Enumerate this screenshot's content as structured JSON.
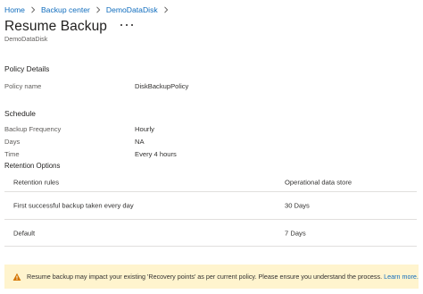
{
  "breadcrumb": {
    "items": [
      "Home",
      "Backup center",
      "DemoDataDisk"
    ]
  },
  "header": {
    "title": "Resume Backup",
    "subtitle": "DemoDataDisk",
    "more_icon": "more-horizontal-icon"
  },
  "policy_details": {
    "heading": "Policy Details",
    "rows": [
      {
        "label": "Policy name",
        "value": "DiskBackupPolicy"
      }
    ]
  },
  "schedule": {
    "heading": "Schedule",
    "rows": [
      {
        "label": "Backup Frequency",
        "value": "Hourly"
      },
      {
        "label": "Days",
        "value": "NA"
      },
      {
        "label": "Time",
        "value": "Every 4 hours"
      }
    ]
  },
  "retention": {
    "heading": "Retention Options",
    "columns": [
      "Retention rules",
      "Operational data store"
    ],
    "rows": [
      [
        "First successful backup taken every day",
        "30 Days"
      ],
      [
        "Default",
        "7 Days"
      ]
    ]
  },
  "warning": {
    "icon": "warning-triangle-icon",
    "text": "Resume backup may impact your existing 'Recovery points' as per current policy. Please ensure you understand the process.",
    "link": "Learn more.",
    "color": "#fff4ce"
  },
  "colors": {
    "link": "#0f6cbd",
    "warning_icon": "#d47500"
  }
}
